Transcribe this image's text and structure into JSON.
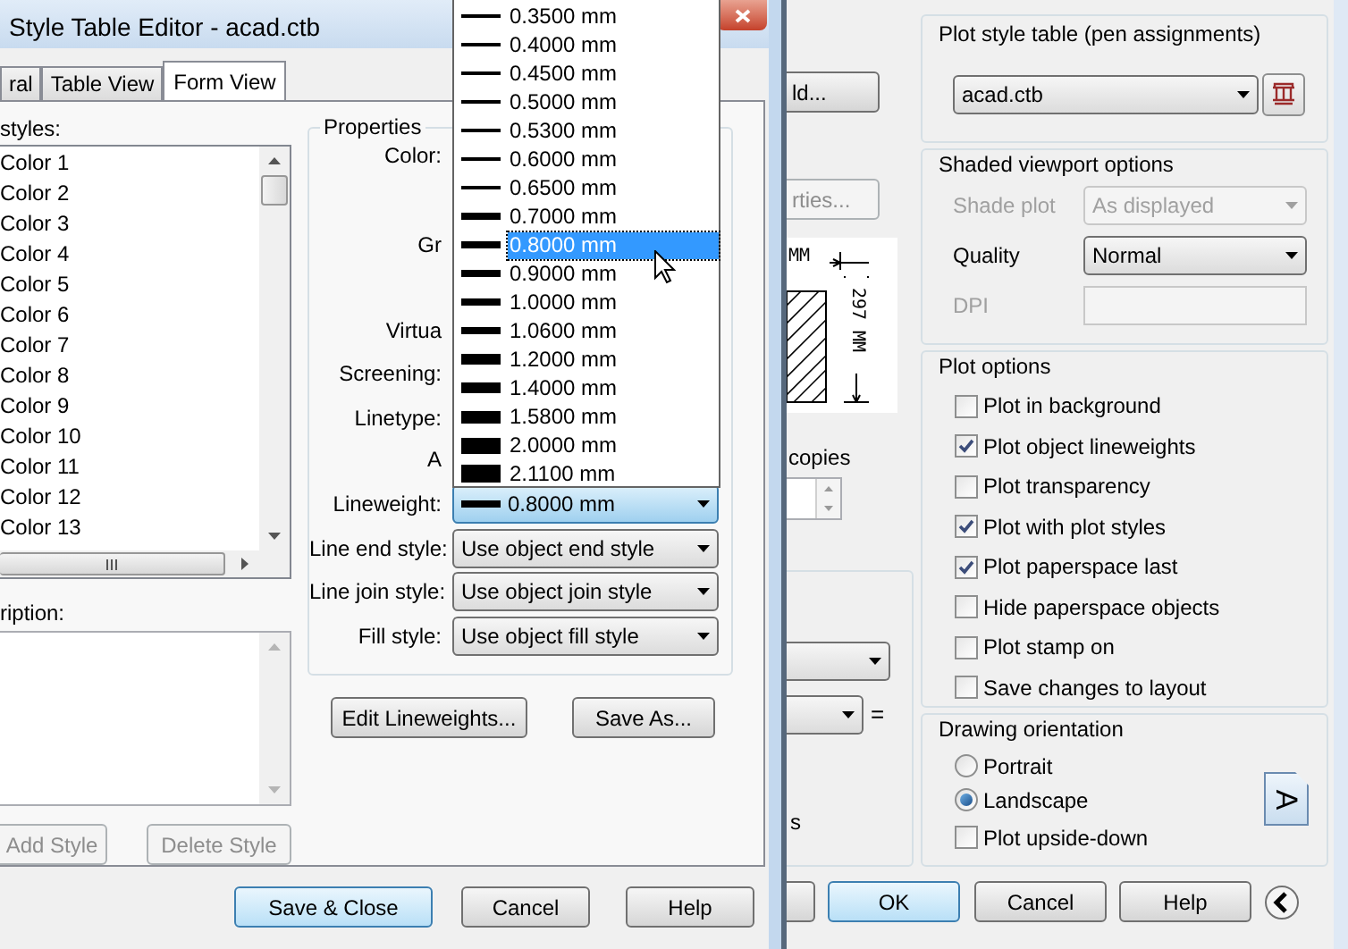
{
  "editor": {
    "title": "Style Table Editor - acad.ctb",
    "tabs": [
      {
        "label": "ral",
        "selected": false
      },
      {
        "label": "Table View",
        "selected": false
      },
      {
        "label": "Form View",
        "selected": true
      }
    ],
    "styles_label": "styles:",
    "styles": [
      {
        "label": "Color 1",
        "selected": false
      },
      {
        "label": "Color 2",
        "selected": false
      },
      {
        "label": "Color 3",
        "selected": false
      },
      {
        "label": "Color 4",
        "selected": false
      },
      {
        "label": "Color 5",
        "selected": false
      },
      {
        "label": "Color 6",
        "selected": false
      },
      {
        "label": "Color 7",
        "selected": false
      },
      {
        "label": "Color 8",
        "selected": false
      },
      {
        "label": "Color 9",
        "selected": false
      },
      {
        "label": "Color 10",
        "selected": false
      },
      {
        "label": "Color 11",
        "selected": false
      },
      {
        "label": "Color 12",
        "selected": false
      },
      {
        "label": "Color 13",
        "selected": false
      }
    ],
    "description_label": "ription:",
    "add_style": {
      "label": "Add Style",
      "disabled": true
    },
    "delete_style": {
      "label": "Delete Style",
      "disabled": true
    },
    "properties": {
      "title": "Properties",
      "rows": [
        {
          "kind": "label",
          "label": "Color:"
        },
        {
          "kind": "label",
          "label": "Gr"
        },
        {
          "kind": "label",
          "label": "Virtua"
        },
        {
          "kind": "label",
          "label": "Screening:"
        },
        {
          "kind": "label",
          "label": "Linetype:"
        },
        {
          "kind": "label",
          "label": "A"
        },
        {
          "kind": "lineweight",
          "label": "Lineweight:",
          "value": "0.8000 mm",
          "focused": true
        },
        {
          "kind": "dropdown",
          "label": "Line end style:",
          "value": "Use object end style",
          "focused": false
        },
        {
          "kind": "dropdown",
          "label": "Line join style:",
          "value": "Use object join style",
          "focused": false
        },
        {
          "kind": "dropdown",
          "label": "Fill style:",
          "value": "Use object fill style",
          "focused": false
        }
      ]
    },
    "edit_lineweights": "Edit Lineweights...",
    "save_as": "Save As...",
    "lineweight_list": [
      {
        "label": "0.3500 mm",
        "selected": false
      },
      {
        "label": "0.4000 mm",
        "selected": false
      },
      {
        "label": "0.4500 mm",
        "selected": false
      },
      {
        "label": "0.5000 mm",
        "selected": false
      },
      {
        "label": "0.5300 mm",
        "selected": false
      },
      {
        "label": "0.6000 mm",
        "selected": false
      },
      {
        "label": "0.6500 mm",
        "selected": false
      },
      {
        "label": "0.7000 mm",
        "selected": false
      },
      {
        "label": "0.8000 mm",
        "selected": true
      },
      {
        "label": "0.9000 mm",
        "selected": false
      },
      {
        "label": "1.0000 mm",
        "selected": false
      },
      {
        "label": "1.0600 mm",
        "selected": false
      },
      {
        "label": "1.2000 mm",
        "selected": false
      },
      {
        "label": "1.4000 mm",
        "selected": false
      },
      {
        "label": "1.5800 mm",
        "selected": false
      },
      {
        "label": "2.0000 mm",
        "selected": false
      },
      {
        "label": "2.1100 mm",
        "selected": false
      }
    ],
    "buttons": [
      {
        "label": "Save & Close",
        "default": true
      },
      {
        "label": "Cancel",
        "default": false
      },
      {
        "label": "Help",
        "default": false
      }
    ]
  },
  "plot": {
    "left_strip": {
      "button_1": "ld...",
      "button_2": {
        "label": "rties...",
        "disabled": true
      },
      "preview": {
        "width_label": "MM",
        "height_label": "297 MM"
      },
      "copies_label": "copies",
      "equals": "=",
      "fragment": "s"
    },
    "plot_style_table": {
      "title": "Plot style table (pen assignments)",
      "value": "acad.ctb"
    },
    "shaded_viewport": {
      "title": "Shaded viewport options",
      "rows": [
        {
          "label": "Shade plot",
          "value": "As displayed",
          "disabled": true
        },
        {
          "label": "Quality",
          "value": "Normal",
          "disabled": false
        },
        {
          "label": "DPI",
          "disabled": true
        }
      ]
    },
    "plot_options": {
      "title": "Plot options",
      "items": [
        {
          "label": "Plot in background",
          "checked": false
        },
        {
          "label": "Plot object lineweights",
          "checked": true
        },
        {
          "label": "Plot transparency",
          "checked": false
        },
        {
          "label": "Plot with plot styles",
          "checked": true
        },
        {
          "label": "Plot paperspace last",
          "checked": true
        },
        {
          "label": "Hide paperspace objects",
          "checked": false
        },
        {
          "label": "Plot stamp on",
          "checked": false
        },
        {
          "label": "Save changes to layout",
          "checked": false
        }
      ]
    },
    "orientation": {
      "title": "Drawing orientation",
      "icon_letter": "A",
      "options": [
        {
          "label": "Portrait",
          "selected": false
        },
        {
          "label": "Landscape",
          "selected": true
        }
      ],
      "upside_down": {
        "label": "Plot upside-down",
        "checked": false
      }
    },
    "buttons": [
      {
        "label": "OK",
        "default": true
      },
      {
        "label": "Cancel",
        "default": false
      },
      {
        "label": "Help",
        "default": false
      }
    ]
  }
}
